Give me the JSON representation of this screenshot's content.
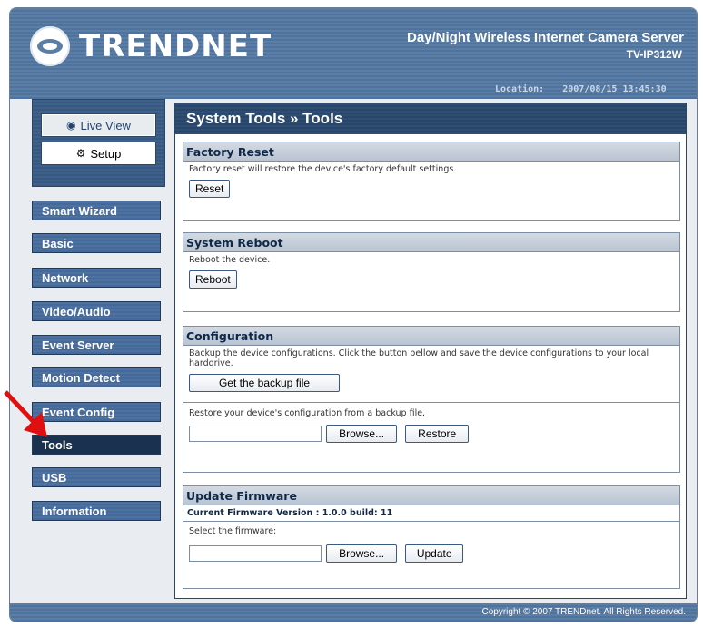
{
  "header": {
    "logo_text": "TRENDNET",
    "product_title": "Day/Night Wireless Internet Camera Server",
    "product_model": "TV-IP312W",
    "location_label": "Location:",
    "datetime": "2007/08/15 13:45:30"
  },
  "sidebar": {
    "live_view": "Live View",
    "setup": "Setup",
    "nav": [
      {
        "label": "Smart Wizard"
      },
      {
        "label": "Basic"
      },
      {
        "label": "Network"
      },
      {
        "label": "Video/Audio"
      },
      {
        "label": "Event Server"
      },
      {
        "label": "Motion Detect"
      },
      {
        "label": "Event Config"
      },
      {
        "label": "Tools",
        "active": true
      },
      {
        "label": "USB"
      },
      {
        "label": "Information"
      }
    ]
  },
  "main": {
    "title": "System Tools » Tools",
    "factory_reset": {
      "title": "Factory Reset",
      "text": "Factory reset will restore the device's factory default settings.",
      "button": "Reset"
    },
    "system_reboot": {
      "title": "System Reboot",
      "text": "Reboot the device.",
      "button": "Reboot"
    },
    "configuration": {
      "title": "Configuration",
      "backup_text": "Backup the device configurations. Click the button bellow and save the device configurations to your local harddrive.",
      "backup_button": "Get the backup file",
      "restore_text": "Restore your device's configuration from a backup file.",
      "browse_button": "Browse...",
      "restore_button": "Restore"
    },
    "firmware": {
      "title": "Update Firmware",
      "version": "Current Firmware Version : 1.0.0 build: 11",
      "select_text": "Select the firmware:",
      "browse_button": "Browse...",
      "update_button": "Update"
    }
  },
  "footer": {
    "copyright": "Copyright © 2007 TRENDnet. All Rights Reserved."
  },
  "colors": {
    "header_blue": "#5b7ea6",
    "dark_navy": "#1a3150",
    "arrow_red": "#e01010"
  }
}
